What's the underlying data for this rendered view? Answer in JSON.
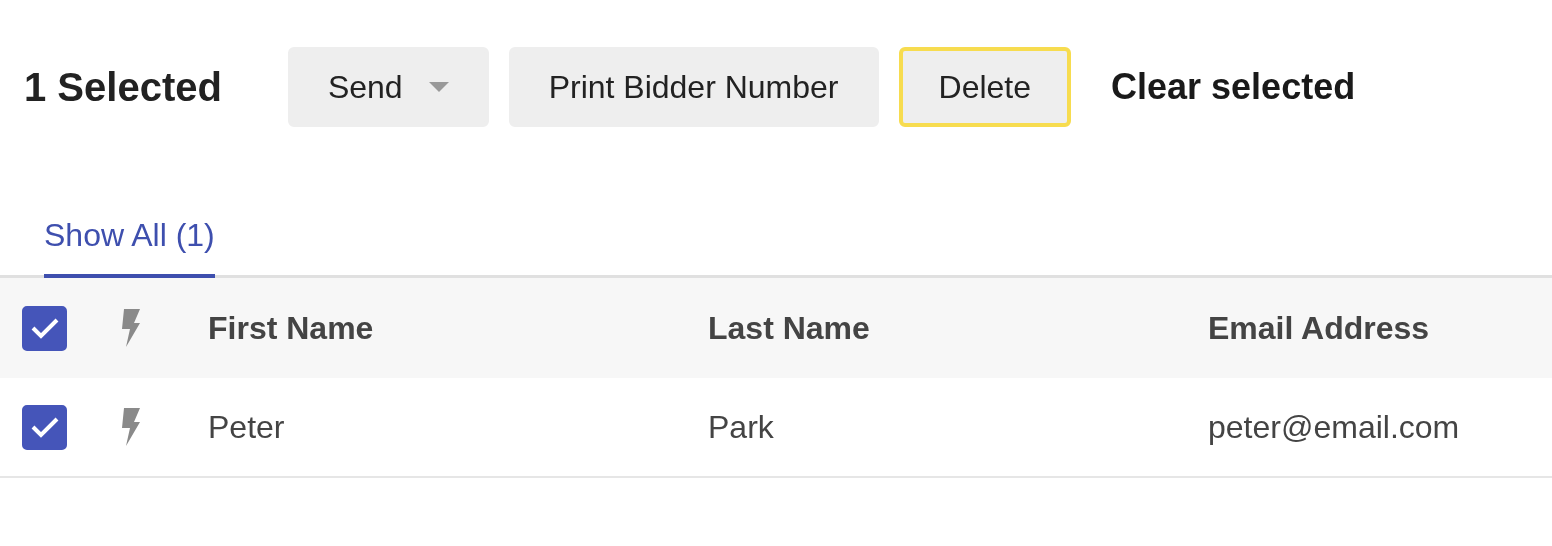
{
  "toolbar": {
    "selection_count": "1 Selected",
    "buttons": [
      {
        "label": "Send",
        "kind": "dropdown",
        "focused": false
      },
      {
        "label": "Print Bidder Number",
        "kind": "plain",
        "focused": false
      },
      {
        "label": "Delete",
        "kind": "plain",
        "focused": true
      }
    ],
    "clear_link": "Clear selected"
  },
  "tabs": [
    {
      "label": "Show All (1)",
      "selected": true
    }
  ],
  "table": {
    "header_checked": true,
    "columns": [
      "First Name",
      "Last Name",
      "Email Address"
    ],
    "rows": [
      {
        "checked": true,
        "cells": [
          "Peter",
          "Park",
          "peter@email.com"
        ]
      }
    ]
  }
}
